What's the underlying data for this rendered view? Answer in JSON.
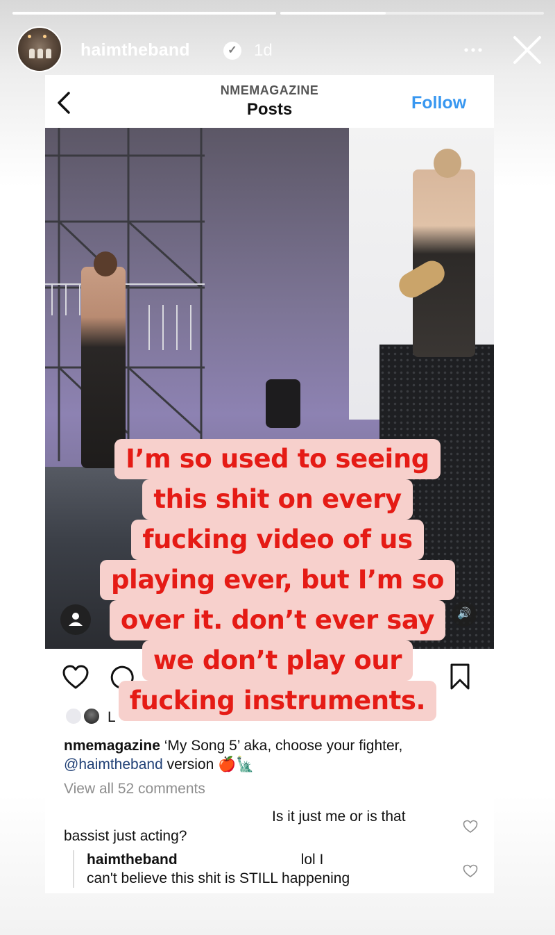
{
  "story": {
    "username": "haimtheband",
    "verified_mark": "✓",
    "timestamp": "1d",
    "more_icon": "more-icon",
    "close_icon": "close-icon",
    "progress": [
      1.0,
      0.4
    ]
  },
  "post": {
    "account": "NMEMAGAZINE",
    "title": "Posts",
    "follow_label": "Follow",
    "sound_glyph": "🔊",
    "likes_initial": "L",
    "caption": {
      "author": "nmemagazine",
      "text": " ‘My Song 5’ aka, choose your fighter,",
      "mention": "@haimtheband",
      "text2": " version 🍎🗽"
    },
    "view_comments": "View all 52 comments",
    "comment1": {
      "text_a": "Is it just me or is that",
      "text_b": "bassist just acting?"
    },
    "reply": {
      "author": "haimtheband",
      "text_a": "lol I",
      "text_b": "can't believe this shit is STILL happening"
    }
  },
  "overlay": {
    "lines": [
      "I’m so used to seeing",
      "this shit on every",
      "fucking video of us",
      "playing ever, but I’m so",
      "over it. don’t ever say",
      "we don’t play our",
      "fucking instruments."
    ]
  },
  "colors": {
    "accent_blue": "#3897f0",
    "overlay_red": "#e51b15",
    "overlay_bg": "#f7d0cc"
  }
}
